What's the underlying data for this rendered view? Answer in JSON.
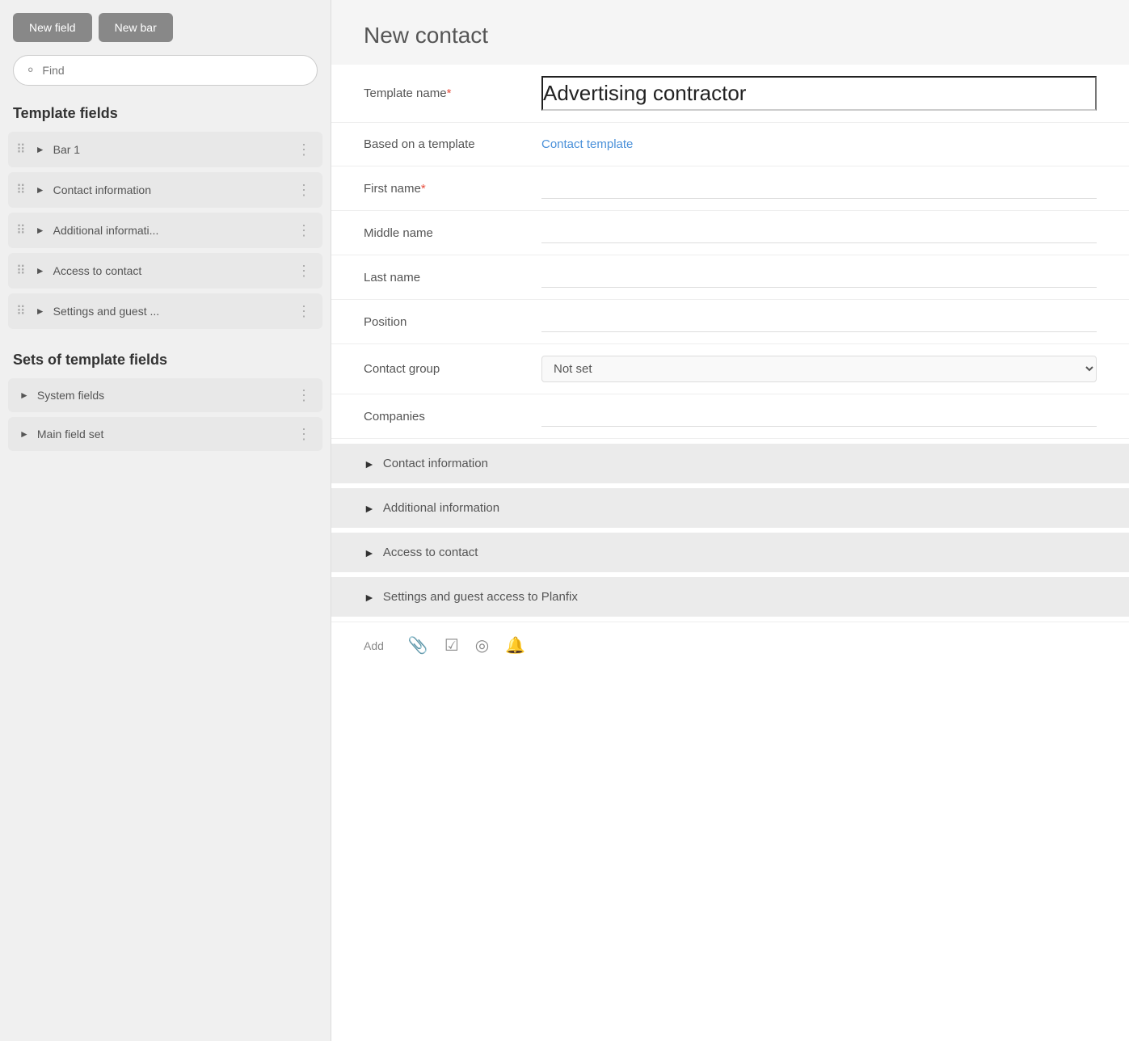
{
  "toolbar": {
    "new_field_label": "New field",
    "new_bar_label": "New bar"
  },
  "search": {
    "placeholder": "Find"
  },
  "left": {
    "template_fields_title": "Template fields",
    "field_items": [
      {
        "label": "Bar 1"
      },
      {
        "label": "Contact information"
      },
      {
        "label": "Additional informati..."
      },
      {
        "label": "Access to contact"
      },
      {
        "label": "Settings and guest ..."
      }
    ],
    "sets_title": "Sets of template fields",
    "set_items": [
      {
        "label": "System fields"
      },
      {
        "label": "Main field set"
      }
    ]
  },
  "right": {
    "page_title": "New contact",
    "template_name_label": "Template name",
    "template_name_value": "Advertising contractor",
    "based_on_label": "Based on a template",
    "based_on_value": "Contact template",
    "first_name_label": "First name",
    "middle_name_label": "Middle name",
    "last_name_label": "Last name",
    "position_label": "Position",
    "contact_group_label": "Contact group",
    "contact_group_value": "Not set",
    "companies_label": "Companies",
    "sections": [
      {
        "label": "Contact information"
      },
      {
        "label": "Additional information"
      },
      {
        "label": "Access to contact"
      },
      {
        "label": "Settings and guest access to Planfix"
      }
    ],
    "footer_add_label": "Add"
  }
}
